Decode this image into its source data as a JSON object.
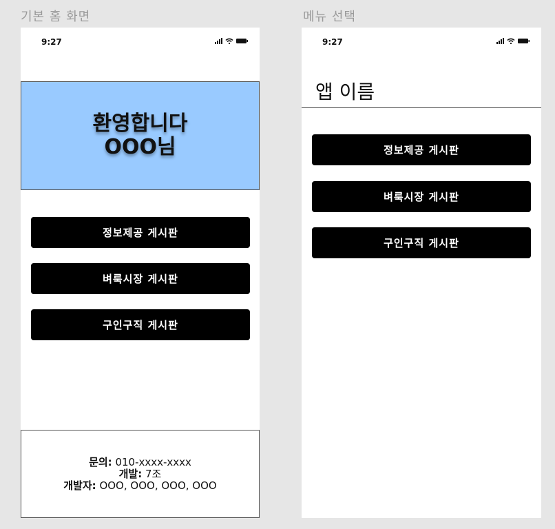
{
  "labels": {
    "home": "기본 홈 화면",
    "menu": "메뉴 선택"
  },
  "status": {
    "time": "9:27"
  },
  "home": {
    "welcome_line1": "환영합니다",
    "welcome_line2": "OOO님",
    "buttons": [
      "정보제공 게시판",
      "벼룩시장 게시판",
      "구인구직 게시판"
    ],
    "contact": {
      "inquiry_label": "문의:",
      "inquiry_value": "010-xxxx-xxxx",
      "dev_label": "개발:",
      "dev_value": "7조",
      "devs_label": "개발자:",
      "devs_value": "OOO, OOO, OOO, OOO"
    }
  },
  "menu": {
    "app_title": "앱 이름",
    "buttons": [
      "정보제공 게시판",
      "벼룩시장 게시판",
      "구인구직 게시판"
    ]
  }
}
